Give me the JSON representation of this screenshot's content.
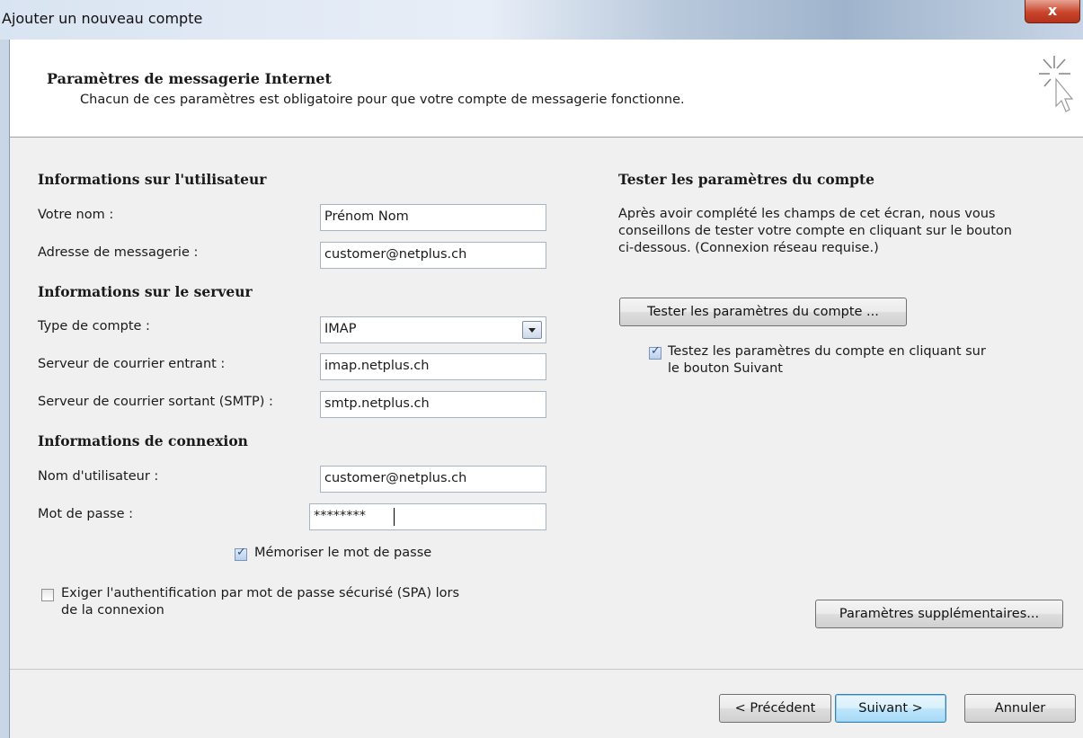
{
  "window": {
    "title": "Ajouter un nouveau compte",
    "close_symbol": "x"
  },
  "header": {
    "title": "Paramètres de messagerie Internet",
    "subtitle": "Chacun de ces paramètres est obligatoire pour que votre compte de messagerie fonctionne."
  },
  "user_info": {
    "heading": "Informations sur l'utilisateur",
    "name_label": "Votre nom :",
    "name_value": "Prénom Nom",
    "email_label": "Adresse de messagerie :",
    "email_value": "customer@netplus.ch"
  },
  "server_info": {
    "heading": "Informations sur le serveur",
    "type_label": "Type de compte :",
    "type_value": "IMAP",
    "incoming_label": "Serveur de courrier entrant :",
    "incoming_value": "imap.netplus.ch",
    "outgoing_label": "Serveur de courrier sortant (SMTP) :",
    "outgoing_value": "smtp.netplus.ch"
  },
  "login_info": {
    "heading": "Informations de connexion",
    "username_label": "Nom d'utilisateur :",
    "username_value": "customer@netplus.ch",
    "password_label": "Mot de passe :",
    "password_value": "********",
    "remember_label": "Mémoriser le mot de passe",
    "remember_checked": true,
    "spa_label_line1": "Exiger l'authentification par mot de passe sécurisé (SPA) lors",
    "spa_label_line2": "de la connexion",
    "spa_checked": false
  },
  "test": {
    "heading": "Tester les paramètres du compte",
    "desc_line1": "Après avoir complété les champs de cet écran, nous vous",
    "desc_line2": "conseillons de tester votre compte en cliquant sur le bouton",
    "desc_line3": "ci-dessous. (Connexion réseau requise.)",
    "test_button": "Tester les paramètres du compte ...",
    "auto_test_line1": "Testez les paramètres du compte en cliquant sur",
    "auto_test_line2": "le bouton Suivant",
    "auto_test_checked": true,
    "more_settings_button": "Paramètres supplémentaires..."
  },
  "footer": {
    "back": "< Précédent",
    "next": "Suivant >",
    "cancel": "Annuler"
  }
}
